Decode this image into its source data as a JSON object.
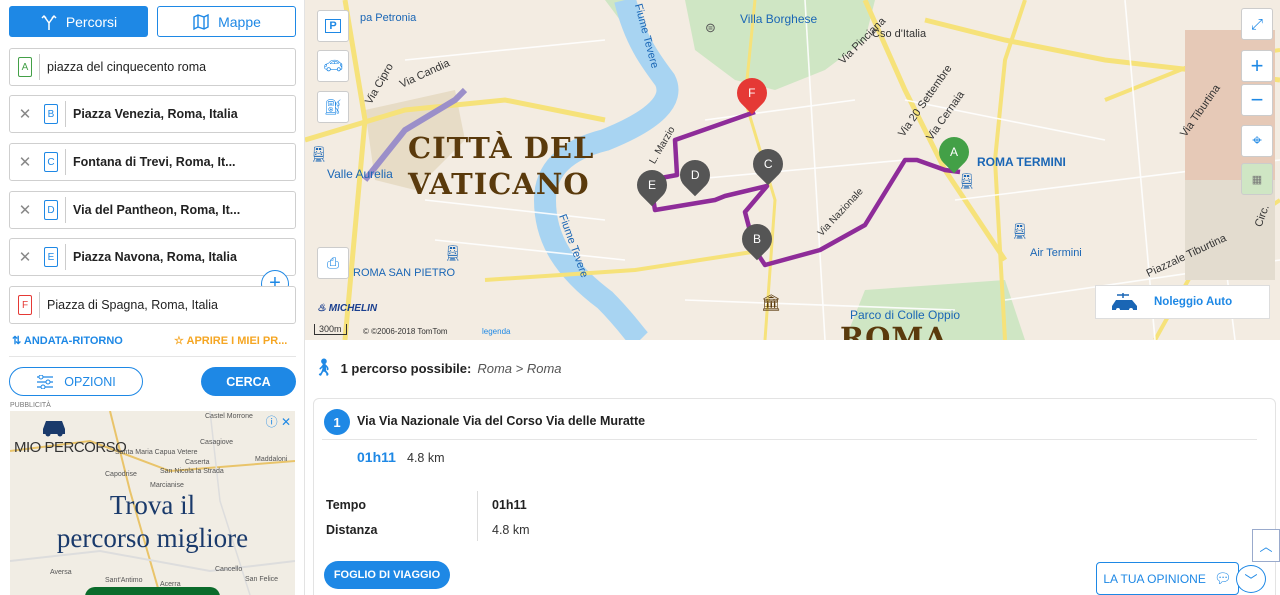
{
  "sidebar": {
    "tabs": [
      {
        "label": "Percorsi",
        "icon": "route-icon",
        "active": true
      },
      {
        "label": "Mappe",
        "icon": "map-icon",
        "active": false
      }
    ],
    "stops": [
      {
        "letter": "A",
        "value": "piazza del cinquecento roma",
        "removable": false,
        "color": "#43a047"
      },
      {
        "letter": "B",
        "value": "Piazza Venezia, Roma, Italia",
        "removable": true,
        "color": "#1e88e5"
      },
      {
        "letter": "C",
        "value": "Fontana di Trevi, Roma, It...",
        "removable": true,
        "color": "#1e88e5"
      },
      {
        "letter": "D",
        "value": "Via del Pantheon, Roma, It...",
        "removable": true,
        "color": "#1e88e5"
      },
      {
        "letter": "E",
        "value": "Piazza Navona, Roma, Italia",
        "removable": true,
        "color": "#1e88e5"
      },
      {
        "letter": "F",
        "value": "Piazza di Spagna, Roma, Italia",
        "removable": false,
        "color": "#e53935"
      }
    ],
    "round_trip_label": "ANDATA-RITORNO",
    "open_my_routes_label": "APRIRE I MIEI PR...",
    "options_label": "OPZIONI",
    "search_label": "CERCA",
    "ad_label": "PUBBLICITÀ",
    "ad": {
      "brand": "MIO PERCORSO",
      "headline_1": "Trova il",
      "headline_2": "percorso migliore",
      "close": "ⓘ ✕",
      "towns": [
        "Castel Morrone",
        "Caserta",
        "Santa Maria Capua Vetere",
        "San Nicola la Strada",
        "Maddaloni",
        "Marcianise",
        "Aversa",
        "Casagiove",
        "Cancello",
        "Acerra",
        "San Felice",
        "Capodrise",
        "Sant'Antimo"
      ]
    }
  },
  "map": {
    "places": [
      {
        "name": "Villa Borghese",
        "color": "#1a66b5"
      },
      {
        "name": "Cso d'Italia",
        "color": "#333"
      },
      {
        "name": "Via Pinciana",
        "color": "#333"
      },
      {
        "name": "Via 20 Settembre",
        "color": "#333"
      },
      {
        "name": "Via Cernaia",
        "color": "#333"
      },
      {
        "name": "Via Tiburtina",
        "color": "#333"
      },
      {
        "name": "ROMA TERMINI",
        "color": "#1a66b5"
      },
      {
        "name": "Air Termini",
        "color": "#1a66b5"
      },
      {
        "name": "Via Nazionale",
        "color": "#333"
      },
      {
        "name": "Piazzale Tiburtina",
        "color": "#333"
      },
      {
        "name": "Circ.",
        "color": "#333"
      },
      {
        "name": "Parco di Colle Oppio",
        "color": "#1a66b5"
      },
      {
        "name": "Valle Aurelia",
        "color": "#1a66b5"
      },
      {
        "name": "Via Candia",
        "color": "#333"
      },
      {
        "name": "Via Cipro",
        "color": "#333"
      },
      {
        "name": "Fiume Tevere",
        "color": "#1a66b5"
      },
      {
        "name": "ROMA SAN PIETRO",
        "color": "#1a66b5"
      },
      {
        "name": "L. Marzio",
        "color": "#333"
      },
      {
        "name": "pa Petronia",
        "color": "#1a66b5"
      }
    ],
    "vatican_line1": "CITTÀ DEL",
    "vatican_line2": "VATICANO",
    "roma_label": "ROMA",
    "markers": [
      "A",
      "B",
      "C",
      "D",
      "E",
      "F"
    ],
    "scale": "300m",
    "copyright": "© ©2006-2018 TomTom",
    "legenda": "legenda",
    "michelin": "MICHELIN",
    "rental_label": "Noleggio Auto",
    "zoom_in": "+",
    "zoom_out": "−"
  },
  "results": {
    "count_text": "1 percorso possibile:",
    "route_text": "Roma > Roma",
    "route": {
      "number": "1",
      "title": "Via Via Nazionale Via del Corso Via delle Muratte",
      "time": "01h11",
      "distance": "4.8 km",
      "time_label": "Tempo",
      "time_value": "01h11",
      "distance_label": "Distanza",
      "distance_value": "4.8 km",
      "sheet_button": "FOGLIO DI VIAGGIO"
    },
    "feedback_label": "LA TUA OPINIONE"
  }
}
